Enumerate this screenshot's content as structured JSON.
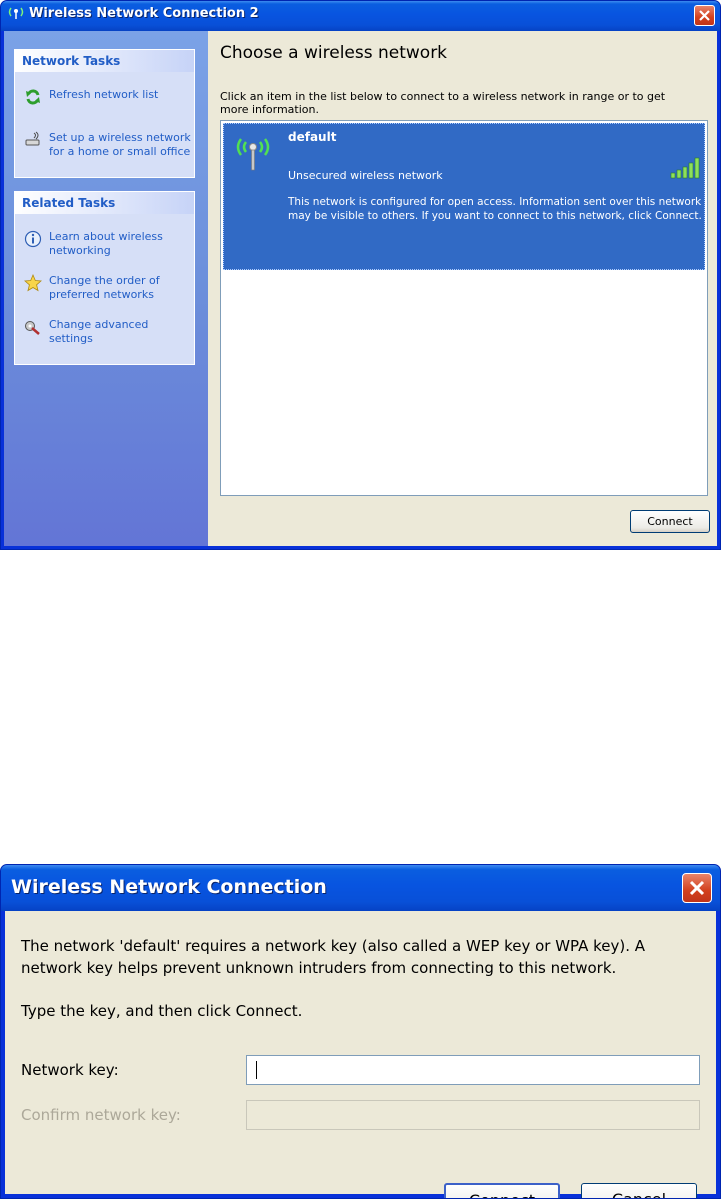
{
  "window1": {
    "title": "Wireless Network Connection 2",
    "network_tasks": {
      "heading": "Network Tasks",
      "items": [
        {
          "label": "Refresh network list",
          "icon": "refresh-icon"
        },
        {
          "label": "Set up a wireless network\nfor a home or small office",
          "icon": "setup-network-icon"
        }
      ]
    },
    "related_tasks": {
      "heading": "Related Tasks",
      "items": [
        {
          "label": "Learn about wireless\nnetworking",
          "icon": "info-icon"
        },
        {
          "label": "Change the order of\npreferred networks",
          "icon": "star-icon"
        },
        {
          "label": "Change advanced\nsettings",
          "icon": "settings-icon"
        }
      ]
    },
    "main": {
      "heading": "Choose a wireless network",
      "instructions": "Click an item in the list below to connect to a wireless network in range or to get more information."
    },
    "networks": [
      {
        "name": "default",
        "security": "Unsecured wireless network",
        "description": "This network is configured for open access. Information sent over this network may be visible to others. If you want to connect to this network, click Connect.",
        "signal_bars": 5,
        "selected": true
      }
    ],
    "connect_button": "Connect",
    "colors": {
      "titlebar": "#0a5ee0",
      "selection": "#316ac5",
      "task_link": "#215dc6"
    }
  },
  "window2": {
    "title": "Wireless Network Connection",
    "message": "The network 'default' requires a network key (also called a WEP key or WPA key). A network key helps prevent unknown intruders from connecting to this network.",
    "instruction": "Type the key, and then click Connect.",
    "network_key_label": "Network key:",
    "network_key_value": "",
    "confirm_key_label": "Confirm network key:",
    "confirm_key_value": "",
    "connect_button": "Connect",
    "cancel_button": "Cancel"
  }
}
